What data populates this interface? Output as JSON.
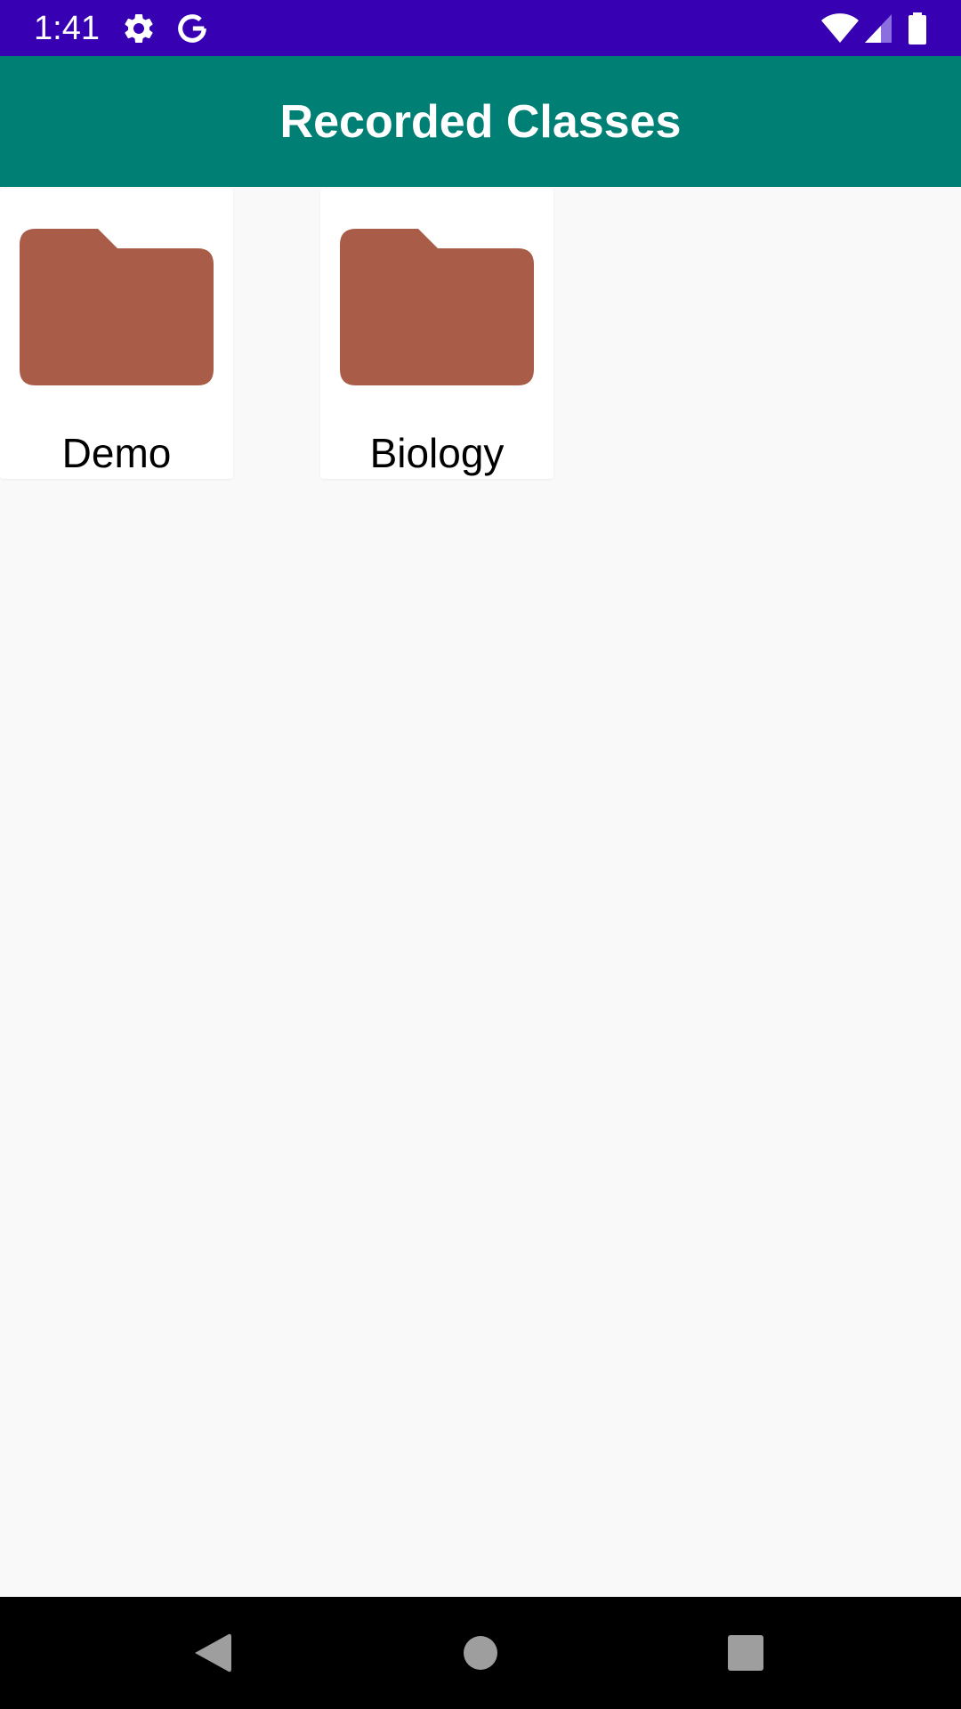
{
  "status_bar": {
    "time": "1:41",
    "icons": [
      "settings-icon",
      "google-icon",
      "wifi-icon",
      "cell-signal-icon",
      "battery-icon"
    ],
    "background": "#3700b3"
  },
  "app_bar": {
    "title": "Recorded Classes",
    "background": "#008074"
  },
  "folders": [
    {
      "label": "Demo",
      "icon": "folder-icon"
    },
    {
      "label": "Biology",
      "icon": "folder-icon"
    }
  ],
  "colors": {
    "folder": "#a95c47",
    "page_background": "#f9f9f9",
    "nav_bar": "#000000",
    "nav_buttons": "#9e9e9e"
  },
  "nav_bar": {
    "buttons": [
      "back-icon",
      "home-icon",
      "recents-icon"
    ]
  }
}
